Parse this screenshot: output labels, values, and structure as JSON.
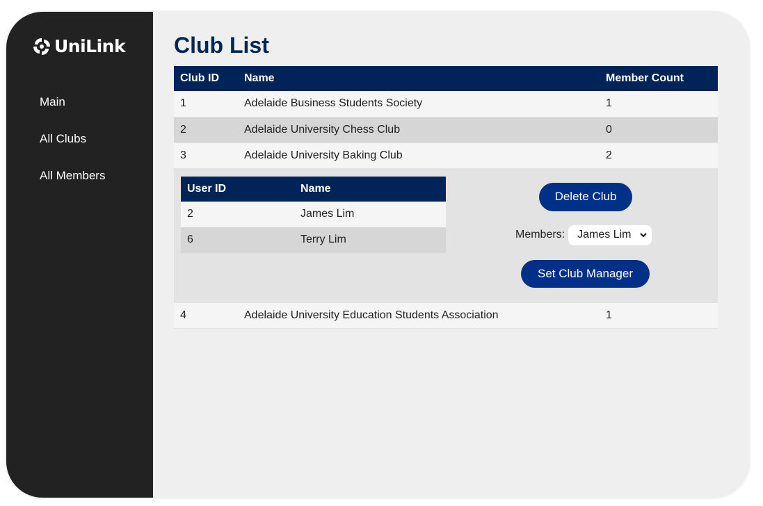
{
  "brand": {
    "name": "UniLink"
  },
  "sidebar": {
    "items": [
      {
        "label": "Main"
      },
      {
        "label": "All Clubs"
      },
      {
        "label": "All Members"
      }
    ]
  },
  "main": {
    "title": "Club List",
    "table": {
      "headers": [
        "Club ID",
        "Name",
        "Member Count"
      ],
      "rows": [
        {
          "id": "1",
          "name": "Adelaide Business Students Society",
          "count": "1"
        },
        {
          "id": "2",
          "name": "Adelaide University Chess Club",
          "count": "0"
        },
        {
          "id": "3",
          "name": "Adelaide University Baking Club",
          "count": "2"
        },
        {
          "id": "4",
          "name": "Adelaide University Education Students Association",
          "count": "1"
        }
      ]
    },
    "expanded": {
      "members_table": {
        "headers": [
          "User ID",
          "Name"
        ],
        "rows": [
          {
            "id": "2",
            "name": "James Lim"
          },
          {
            "id": "6",
            "name": "Terry Lim"
          }
        ]
      },
      "delete_label": "Delete Club",
      "members_label": "Members:",
      "members_selected": "James Lim",
      "set_manager_label": "Set Club Manager"
    }
  },
  "colors": {
    "sidebar": "#222222",
    "header": "#002457",
    "title": "#002855",
    "button": "#003087"
  }
}
